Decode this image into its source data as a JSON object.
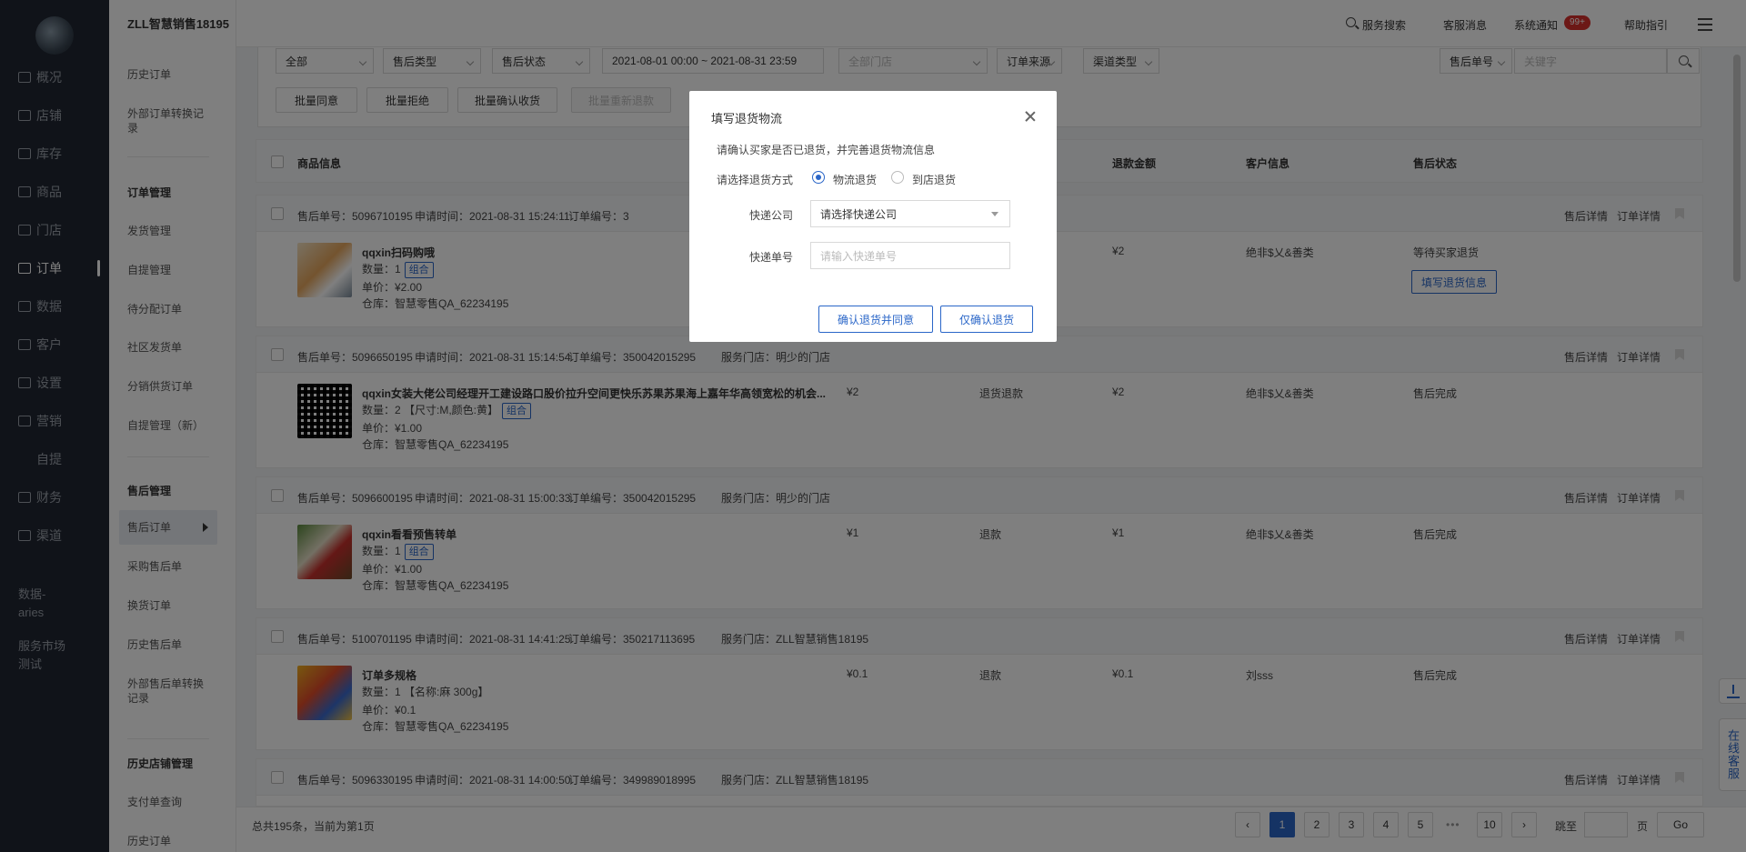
{
  "brand": "ZLL智慧销售18195",
  "header": {
    "search": "服务搜索",
    "service_msg": "客服消息",
    "notice": "系统通知",
    "notice_badge": "99+",
    "help": "帮助指引"
  },
  "nav1": [
    "概况",
    "店铺",
    "库存",
    "商品",
    "门店",
    "订单",
    "数据",
    "客户",
    "设置",
    "营销",
    "自提",
    "财务",
    "渠道"
  ],
  "nav1_extra": [
    "数据-\naries",
    "服务市场\n测试"
  ],
  "nav2": {
    "top_items": [
      "历史订单",
      "外部订单转换记\n录"
    ],
    "order_head": "订单管理",
    "order_items": [
      "发货管理",
      "自提管理",
      "待分配订单",
      "社区发货单",
      "分销供货订单",
      "自提管理（新）"
    ],
    "after_head": "售后管理",
    "after_items": [
      "售后订单",
      "采购售后单",
      "换货订单",
      "历史售后单",
      "外部售后单转换\n记录"
    ],
    "history_head": "历史店铺管理",
    "history_items": [
      "支付单查询",
      "历史订单"
    ]
  },
  "filters": {
    "all": "全部",
    "after_type": "售后类型",
    "after_status": "售后状态",
    "date_range": "2021-08-01 00:00 ~ 2021-08-31 23:59",
    "store": "全部门店",
    "source": "订单来源",
    "channel": "渠道类型",
    "search_type": "售后单号",
    "keyword_placeholder": "关键字",
    "batch_agree": "批量同意",
    "batch_reject": "批量拒绝",
    "batch_confirm": "批量确认收货",
    "batch_refund": "批量重新退款"
  },
  "table": {
    "headers": [
      "商品信息",
      "退款金额",
      "客户信息",
      "售后状态"
    ],
    "detail_after": "售后详情",
    "detail_order": "订单详情",
    "qty_label": "数量：",
    "price_label": "单价：",
    "warehouse_label": "仓库：",
    "orders": [
      {
        "after_no": "售后单号：5096710195",
        "apply_time": "申请时间：2021-08-31 15:24:11",
        "order_no": "订单编号：3",
        "store": "",
        "name": "qqxin扫码购哦",
        "qty": "1",
        "spec": "",
        "tag": "组合",
        "price": "¥2.00",
        "warehouse": "智慧零售QA_62234195",
        "amount": "",
        "type": "",
        "refund": "¥2",
        "customer": "绝非$乂&善类",
        "status": "等待买家退货",
        "action": "填写退货信息"
      },
      {
        "after_no": "售后单号：5096650195",
        "apply_time": "申请时间：2021-08-31 15:14:54",
        "order_no": "订单编号：350042015295",
        "store": "服务门店：明少的门店",
        "name": "qqxin女装大佬公司经理开工建设路口股价拉升空间更快乐苏果苏果海上嘉年华高领宽松的机会...",
        "qty": "2",
        "spec": "【尺寸:M,颜色:黄】",
        "tag": "组合",
        "price": "¥1.00",
        "warehouse": "智慧零售QA_62234195",
        "amount": "¥2",
        "type": "退货退款",
        "refund": "¥2",
        "customer": "绝非$乂&善类",
        "status": "售后完成",
        "action": ""
      },
      {
        "after_no": "售后单号：5096600195",
        "apply_time": "申请时间：2021-08-31 15:00:33",
        "order_no": "订单编号：350042015295",
        "store": "服务门店：明少的门店",
        "name": "qqxin看看预售转单",
        "qty": "1",
        "spec": "",
        "tag": "组合",
        "price": "¥1.00",
        "warehouse": "智慧零售QA_62234195",
        "amount": "¥1",
        "type": "退款",
        "refund": "¥1",
        "customer": "绝非$乂&善类",
        "status": "售后完成",
        "action": ""
      },
      {
        "after_no": "售后单号：5100701195",
        "apply_time": "申请时间：2021-08-31 14:41:25",
        "order_no": "订单编号：350217113695",
        "store": "服务门店：ZLL智慧销售18195",
        "name": "订单多规格",
        "qty": "1",
        "spec": "【名称:麻 300g】",
        "tag": "",
        "price": "¥0.1",
        "warehouse": "智慧零售QA_62234195",
        "amount": "¥0.1",
        "type": "退款",
        "refund": "¥0.1",
        "customer": "刘sss",
        "status": "售后完成",
        "action": ""
      },
      {
        "after_no": "售后单号：5096330195",
        "apply_time": "申请时间：2021-08-31 14:00:50",
        "order_no": "订单编号：349989018995",
        "store": "服务门店：ZLL智慧销售18195",
        "name": "",
        "qty": "",
        "spec": "",
        "tag": "",
        "price": "",
        "warehouse": "",
        "amount": "",
        "type": "",
        "refund": "",
        "customer": "",
        "status": "",
        "action": ""
      }
    ]
  },
  "pagination": {
    "summary": "总共195条，当前为第1页",
    "pages": [
      "1",
      "2",
      "3",
      "4",
      "5"
    ],
    "ellipsis": "•••",
    "last": "10",
    "jump_label": "跳至",
    "page_unit": "页",
    "go": "Go",
    "current": 1
  },
  "side": {
    "online_service": "在线客服"
  },
  "modal": {
    "title": "填写退货物流",
    "tip": "请确认买家是否已退货，并完善退货物流信息",
    "method_label": "请选择退货方式",
    "method_options": [
      "物流退货",
      "到店退货"
    ],
    "method_selected": "物流退货",
    "company_label": "快递公司",
    "company_placeholder": "请选择快递公司",
    "tracking_label": "快递单号",
    "tracking_placeholder": "请输入快递单号",
    "confirm_agree": "确认退货并同意",
    "confirm_only": "仅确认退货"
  },
  "colors": {
    "primary": "#2a66c8",
    "nav_bg": "#202632",
    "badge": "#d9302c"
  }
}
